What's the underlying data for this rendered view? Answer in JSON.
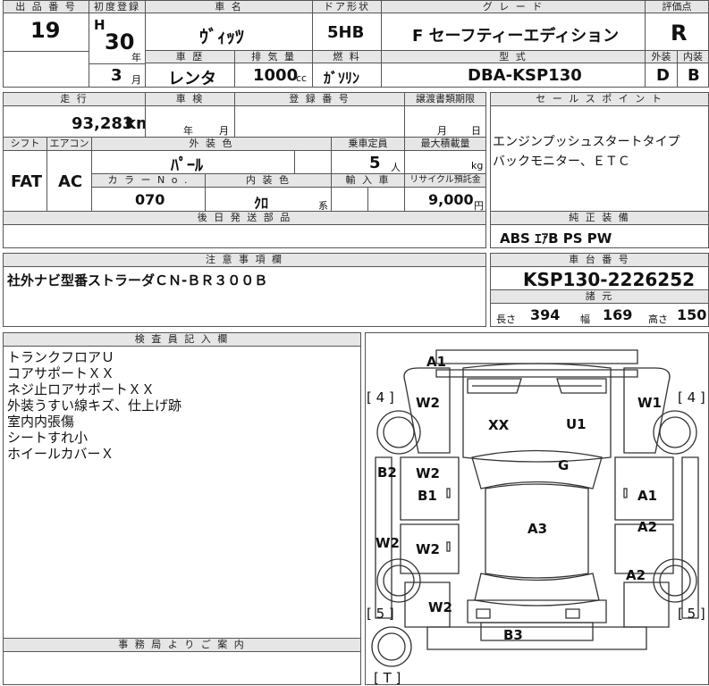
{
  "headers": {
    "lot_no": "出 品 番 号",
    "first_reg": "初度登録",
    "car_name": "車 名",
    "door": "ドア形状",
    "grade": "グ レ ー ド",
    "rating": "評価点",
    "history": "車 歴",
    "displacement": "排 気 量",
    "fuel": "燃 料",
    "model": "型 式",
    "exterior": "外装",
    "interior": "内装",
    "mileage": "走 行",
    "inspection": "車 検",
    "reg_no": "登 録 番 号",
    "transfer_deadline": "譲渡書類期限",
    "sales_point": "セ ー ル ス ポ イ ン ト",
    "shift": "シフト",
    "aircon": "エアコン",
    "ext_color": "外 装 色",
    "capacity": "乗車定員",
    "max_load": "最大積載量",
    "color_no": "カ ラ ー N o .",
    "int_color": "内 装 色",
    "import": "輸 入 車",
    "recycle": "リサイクル預託金",
    "later_parts": "後 日 発 送 部 品",
    "genuine_equip": "純 正 装 備",
    "notes": "注 意 事 項 欄",
    "chassis_no": "車 台 番 号",
    "dimensions": "諸 元",
    "inspector": "検 査 員 記 入 欄",
    "office": "事 務 局 よ り ご 案 内"
  },
  "values": {
    "lot_no": "19",
    "era": "H",
    "year": "30",
    "year_unit": "年",
    "month": "3",
    "month_unit": "月",
    "car_name": "ｳﾞｨｯﾂ",
    "door": "5HB",
    "grade": "F セーフティーエディション",
    "rating": "R",
    "history": "レンタ",
    "displacement": "1000",
    "displacement_unit": "cc",
    "fuel": "ｶﾞｿﾘﾝ",
    "model": "DBA-KSP130",
    "exterior": "D",
    "interior": "B",
    "mileage": "93,283",
    "mileage_unit": "km",
    "inspection_year": "年",
    "inspection_month": "月",
    "transfer_month": "月",
    "transfer_day": "日",
    "shift": "FAT",
    "aircon": "AC",
    "ext_color": "ﾊﾟｰﾙ",
    "capacity": "5",
    "capacity_unit": "人",
    "max_load_unit": "kg",
    "color_no": "070",
    "int_color": "ｸﾛ",
    "int_color_suffix": "系",
    "recycle": "9,000",
    "recycle_unit": "円",
    "sales_point_line1": "エンジンプッシュスタートタイプ",
    "sales_point_line2": "バックモニター、ＥＴＣ",
    "genuine_equip": "ABS ｴｱB PS PW",
    "notes": "社外ナビ型番ストラーダＣＮ-ＢＲ３００Ｂ",
    "chassis_no": "KSP130-2226252",
    "length_label": "長さ",
    "length": "394",
    "width_label": "幅",
    "width": "169",
    "height_label": "高さ",
    "height": "150"
  },
  "inspector_lines": [
    "トランクフロアＵ",
    "コアサポートＸＸ",
    "ネジ止ロアサポートＸＸ",
    "外装うすい線キズ、仕上げ跡",
    "室内内張傷",
    "シートすれ小",
    "ホイールカバーＸ"
  ],
  "diagram": {
    "codes": {
      "front_a1": "A1",
      "hood_xx": "XX",
      "hood_u1": "U1",
      "front_left_w2": "W2",
      "front_right_w1": "W1",
      "windshield_g": "G",
      "left_b2": "B2",
      "left_front_door_w2": "W2",
      "left_front_door_b1": "B1",
      "right_front_door_a1": "A1",
      "roof_a3": "A3",
      "right_rear_door_a2": "A2",
      "left_w2": "W2",
      "left_rear_door_w2": "W2",
      "right_rear_fender_a2": "A2",
      "rear_left_w2": "W2",
      "rear_b3": "B3",
      "left_front_tire": "[ 4 ]",
      "right_front_tire": "[ 4 ]",
      "left_rear_tire": "[ 5 ]",
      "right_rear_tire": "[ 5 ]",
      "spare_tire": "[ T ]"
    }
  }
}
